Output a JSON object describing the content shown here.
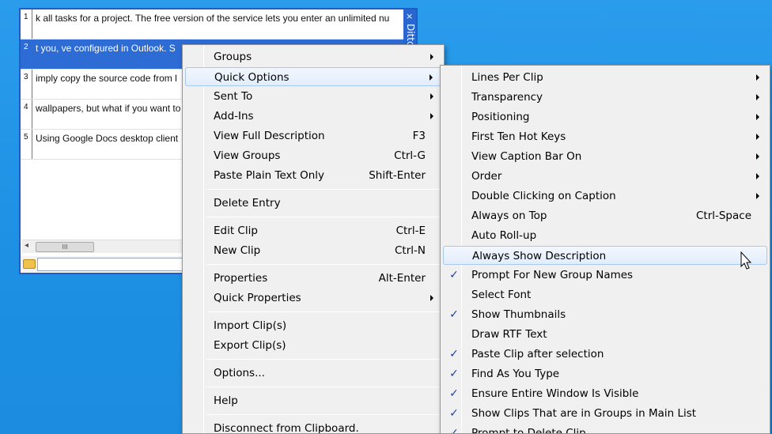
{
  "ditto": {
    "title": "Ditto",
    "close_glyph": "×",
    "clips": [
      {
        "num": "1",
        "text": "k all tasks for a project. The free version of the service lets you enter an unlimited nu"
      },
      {
        "num": "2",
        "text": "t you,  ve configured in Outlook. S",
        "selected": true
      },
      {
        "num": "3",
        "text": "imply copy the source code from l"
      },
      {
        "num": "4",
        "text": "wallpapers, but what if you want to"
      },
      {
        "num": "5",
        "text": "Using Google Docs desktop client"
      }
    ],
    "scroll_left_glyph": "◂",
    "scroll_thumb_grip": "III",
    "search_value": ""
  },
  "main_menu": {
    "items": [
      {
        "label": "Groups",
        "arrow": true
      },
      {
        "label": "Quick Options",
        "arrow": true,
        "hover": true
      },
      {
        "label": "Sent To",
        "arrow": true
      },
      {
        "label": "Add-Ins",
        "arrow": true
      },
      {
        "label": "View Full Description",
        "shortcut": "F3"
      },
      {
        "label": "View Groups",
        "shortcut": "Ctrl-G"
      },
      {
        "label": "Paste Plain Text Only",
        "shortcut": "Shift-Enter"
      },
      {
        "separator": true
      },
      {
        "label": "Delete Entry"
      },
      {
        "separator": true
      },
      {
        "label": "Edit Clip",
        "shortcut": "Ctrl-E"
      },
      {
        "label": "New Clip",
        "shortcut": "Ctrl-N"
      },
      {
        "separator": true
      },
      {
        "label": "Properties",
        "shortcut": "Alt-Enter"
      },
      {
        "label": "Quick Properties",
        "arrow": true
      },
      {
        "separator": true
      },
      {
        "label": "Import Clip(s)"
      },
      {
        "label": "Export Clip(s)"
      },
      {
        "separator": true
      },
      {
        "label": "Options..."
      },
      {
        "separator": true
      },
      {
        "label": "Help"
      },
      {
        "separator": true
      },
      {
        "label": "Disconnect from Clipboard."
      }
    ]
  },
  "quick_options_menu": {
    "check_glyph": "✓",
    "items": [
      {
        "label": "Lines Per Clip",
        "arrow": true
      },
      {
        "label": "Transparency",
        "arrow": true
      },
      {
        "label": "Positioning",
        "arrow": true
      },
      {
        "label": "First Ten Hot Keys",
        "arrow": true
      },
      {
        "label": "View Caption Bar On",
        "arrow": true
      },
      {
        "label": "Order",
        "arrow": true
      },
      {
        "label": "Double Clicking on Caption",
        "arrow": true
      },
      {
        "label": "Always on Top",
        "shortcut": "Ctrl-Space"
      },
      {
        "label": "Auto Roll-up"
      },
      {
        "label": "Always Show Description",
        "hover": true
      },
      {
        "label": "Prompt For New Group Names",
        "checked": true
      },
      {
        "label": "Select Font"
      },
      {
        "label": "Show Thumbnails",
        "checked": true
      },
      {
        "label": "Draw RTF Text"
      },
      {
        "label": "Paste Clip after selection",
        "checked": true
      },
      {
        "label": "Find As You Type",
        "checked": true
      },
      {
        "label": "Ensure Entire Window Is Visible",
        "checked": true
      },
      {
        "label": "Show Clips That are in Groups in Main List",
        "checked": true
      },
      {
        "label": "Prompt to Delete Clip",
        "checked": true
      }
    ]
  },
  "colors": {
    "desktop": "#1e93e6",
    "selection": "#2d6bd5",
    "caption_bar": "#2a66cf",
    "check": "#1e3fa0"
  }
}
